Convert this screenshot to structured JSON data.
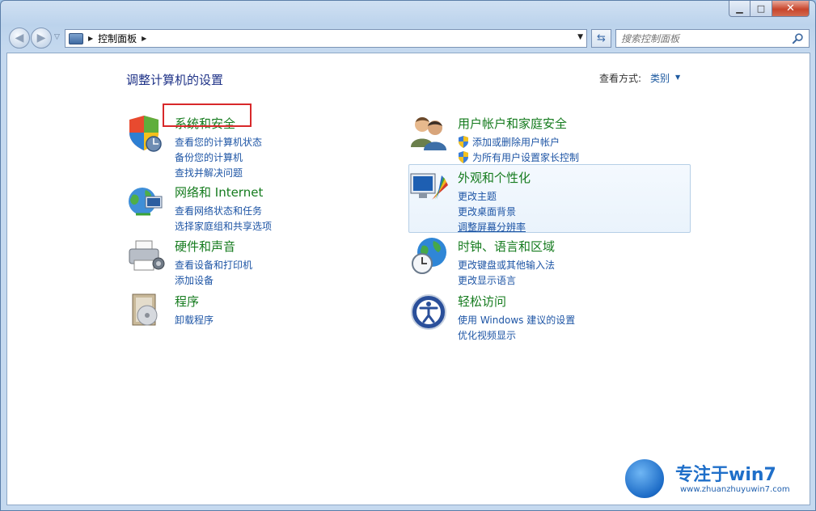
{
  "window": {
    "close_glyph": "✕",
    "minimize_glyph": "▁",
    "maximize_glyph": "□"
  },
  "navbar": {
    "back_glyph": "◀",
    "forward_glyph": "▶",
    "breadcrumb": "控制面板",
    "search_placeholder": "搜索控制面板"
  },
  "main": {
    "title": "调整计算机的设置",
    "view_by_label": "查看方式:",
    "view_by_value": "类别"
  },
  "categories_left": [
    {
      "icon": "shield-icon",
      "title": "系统和安全",
      "links": [
        {
          "label": "查看您的计算机状态",
          "shield": false
        },
        {
          "label": "备份您的计算机",
          "shield": false
        },
        {
          "label": "查找并解决问题",
          "shield": false
        }
      ]
    },
    {
      "icon": "network-icon",
      "title": "网络和 Internet",
      "links": [
        {
          "label": "查看网络状态和任务",
          "shield": false
        },
        {
          "label": "选择家庭组和共享选项",
          "shield": false
        }
      ]
    },
    {
      "icon": "printer-icon",
      "title": "硬件和声音",
      "links": [
        {
          "label": "查看设备和打印机",
          "shield": false
        },
        {
          "label": "添加设备",
          "shield": false
        }
      ]
    },
    {
      "icon": "programs-icon",
      "title": "程序",
      "links": [
        {
          "label": "卸载程序",
          "shield": false
        }
      ]
    }
  ],
  "categories_right": [
    {
      "icon": "users-icon",
      "title": "用户帐户和家庭安全",
      "links": [
        {
          "label": "添加或删除用户帐户",
          "shield": true
        },
        {
          "label": "为所有用户设置家长控制",
          "shield": true
        }
      ]
    },
    {
      "icon": "appearance-icon",
      "title": "外观和个性化",
      "links": [
        {
          "label": "更改主题",
          "shield": false
        },
        {
          "label": "更改桌面背景",
          "shield": false
        },
        {
          "label": "调整屏幕分辨率",
          "shield": false
        }
      ]
    },
    {
      "icon": "clock-globe-icon",
      "title": "时钟、语言和区域",
      "links": [
        {
          "label": "更改键盘或其他输入法",
          "shield": false
        },
        {
          "label": "更改显示语言",
          "shield": false
        }
      ]
    },
    {
      "icon": "ease-of-access-icon",
      "title": "轻松访问",
      "links": [
        {
          "label": "使用 Windows 建议的设置",
          "shield": false
        },
        {
          "label": "优化视频显示",
          "shield": false
        }
      ]
    }
  ],
  "watermark": {
    "text": "专注于win7",
    "url": "www.zhuanzhuyuwin7.com"
  }
}
